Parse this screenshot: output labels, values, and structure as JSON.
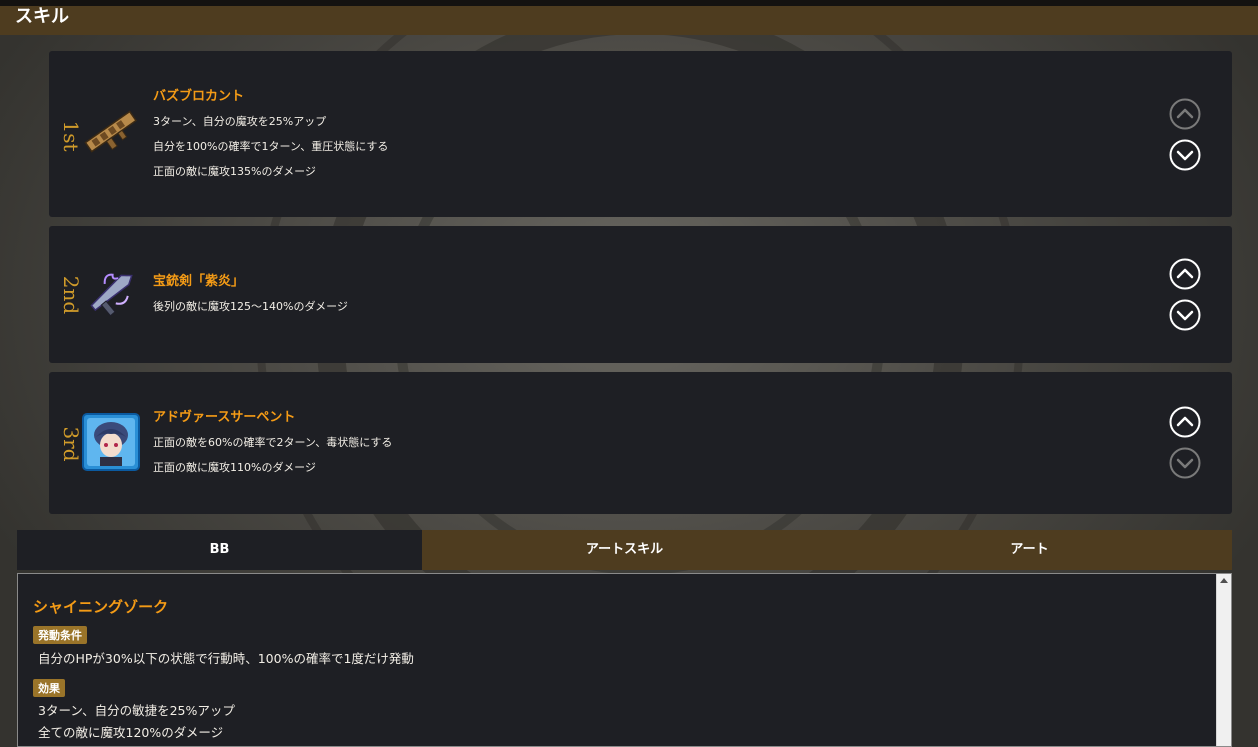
{
  "header": {
    "title": "スキル"
  },
  "skills": [
    {
      "rank": "1st",
      "name": "バズブロカント",
      "lines": [
        "3ターン、自分の魔攻を25%アップ",
        "自分を100%の確率で1ターン、重圧状態にする",
        "正面の敵に魔攻135%のダメージ"
      ],
      "icon": "bazooka-icon",
      "up_active": false,
      "down_active": true
    },
    {
      "rank": "2nd",
      "name": "宝銃剣「紫炎」",
      "lines": [
        "後列の敵に魔攻125～140%のダメージ"
      ],
      "icon": "gun-sword-icon",
      "up_active": true,
      "down_active": true
    },
    {
      "rank": "3rd",
      "name": "アドヴァースサーペント",
      "lines": [
        "正面の敵を60%の確率で2ターン、毒状態にする",
        "正面の敵に魔攻110%のダメージ"
      ],
      "icon": "character-portrait-icon",
      "up_active": true,
      "down_active": false
    }
  ],
  "tabs": [
    {
      "label": "BB",
      "active": true
    },
    {
      "label": "アートスキル",
      "active": false
    },
    {
      "label": "アート",
      "active": false
    }
  ],
  "panel": {
    "name": "シャイニングゾーク",
    "condition_label": "発動条件",
    "condition_text": "自分のHPが30%以下の状態で行動時、100%の確率で1度だけ発動",
    "effect_label": "効果",
    "effect_lines": [
      "3ターン、自分の敏捷を25%アップ",
      "全ての敵に魔攻120%のダメージ"
    ]
  },
  "colors": {
    "accent": "#f49b16",
    "header": "#4e3c1f",
    "card": "#1e1f24",
    "rank": "#d09b2a",
    "badge": "#9a7429"
  }
}
